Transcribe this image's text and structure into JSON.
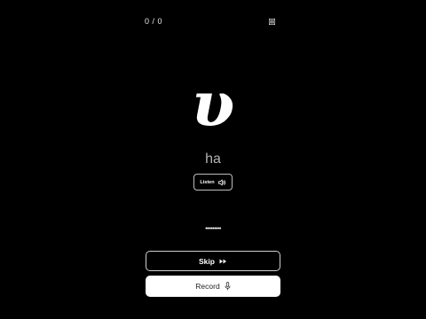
{
  "progress": {
    "counter": "0 / 0"
  },
  "toolbar": {
    "pause_icon": "pause-icon"
  },
  "card": {
    "glyph": "υ",
    "romanization": "ha"
  },
  "listen": {
    "label": "Listen",
    "icon": "speaker-icon"
  },
  "input": {
    "masked_value": "•••••••••"
  },
  "actions": {
    "skip_label": "Skip",
    "skip_icon": "fast-forward-icon",
    "record_label": "Record",
    "record_icon": "microphone-icon"
  },
  "colors": {
    "background": "#000000",
    "text": "#ffffff",
    "muted_text": "#b3b3b3",
    "record_bg": "#ffffff"
  }
}
